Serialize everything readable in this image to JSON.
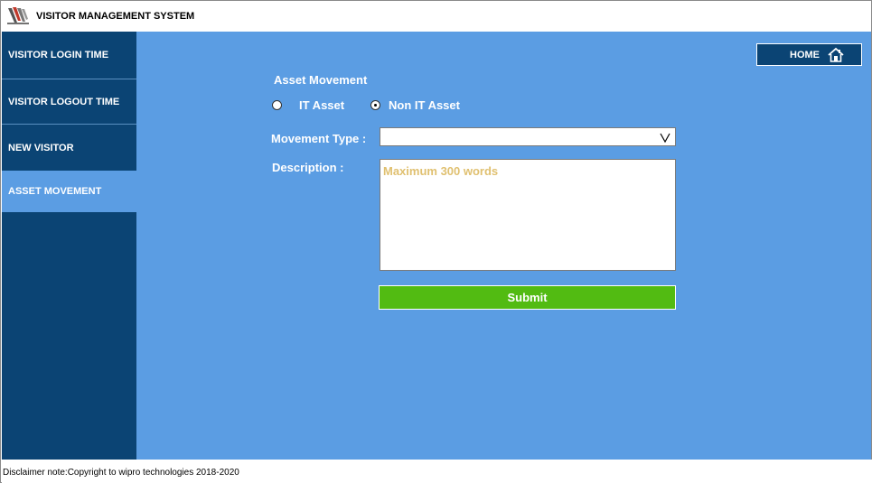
{
  "app": {
    "title": "VISITOR MANAGEMENT SYSTEM",
    "logo_icon": "wipro-logo-icon"
  },
  "sidebar": {
    "items": [
      {
        "label": "VISITOR LOGIN TIME",
        "active": false
      },
      {
        "label": "VISITOR LOGOUT TIME",
        "active": false
      },
      {
        "label": "NEW VISITOR",
        "active": false
      },
      {
        "label": "ASSET MOVEMENT",
        "active": true
      }
    ]
  },
  "header": {
    "home_label": "HOME",
    "home_icon": "home-icon"
  },
  "form": {
    "section_title": "Asset Movement",
    "asset_type": {
      "options": [
        {
          "label": "IT Asset",
          "selected": false
        },
        {
          "label": "Non IT Asset",
          "selected": true
        }
      ]
    },
    "movement_type_label": "Movement Type :",
    "movement_type_value": "",
    "description_label": "Description :",
    "description_placeholder": "Maximum 300 words",
    "submit_label": "Submit"
  },
  "footer": {
    "text": "Disclaimer note:Copyright to wipro technologies 2018-2020"
  },
  "colors": {
    "sidebar_bg": "#0b4474",
    "main_bg": "#5b9de3",
    "submit_bg": "#52bb12",
    "placeholder": "#e0c070"
  }
}
